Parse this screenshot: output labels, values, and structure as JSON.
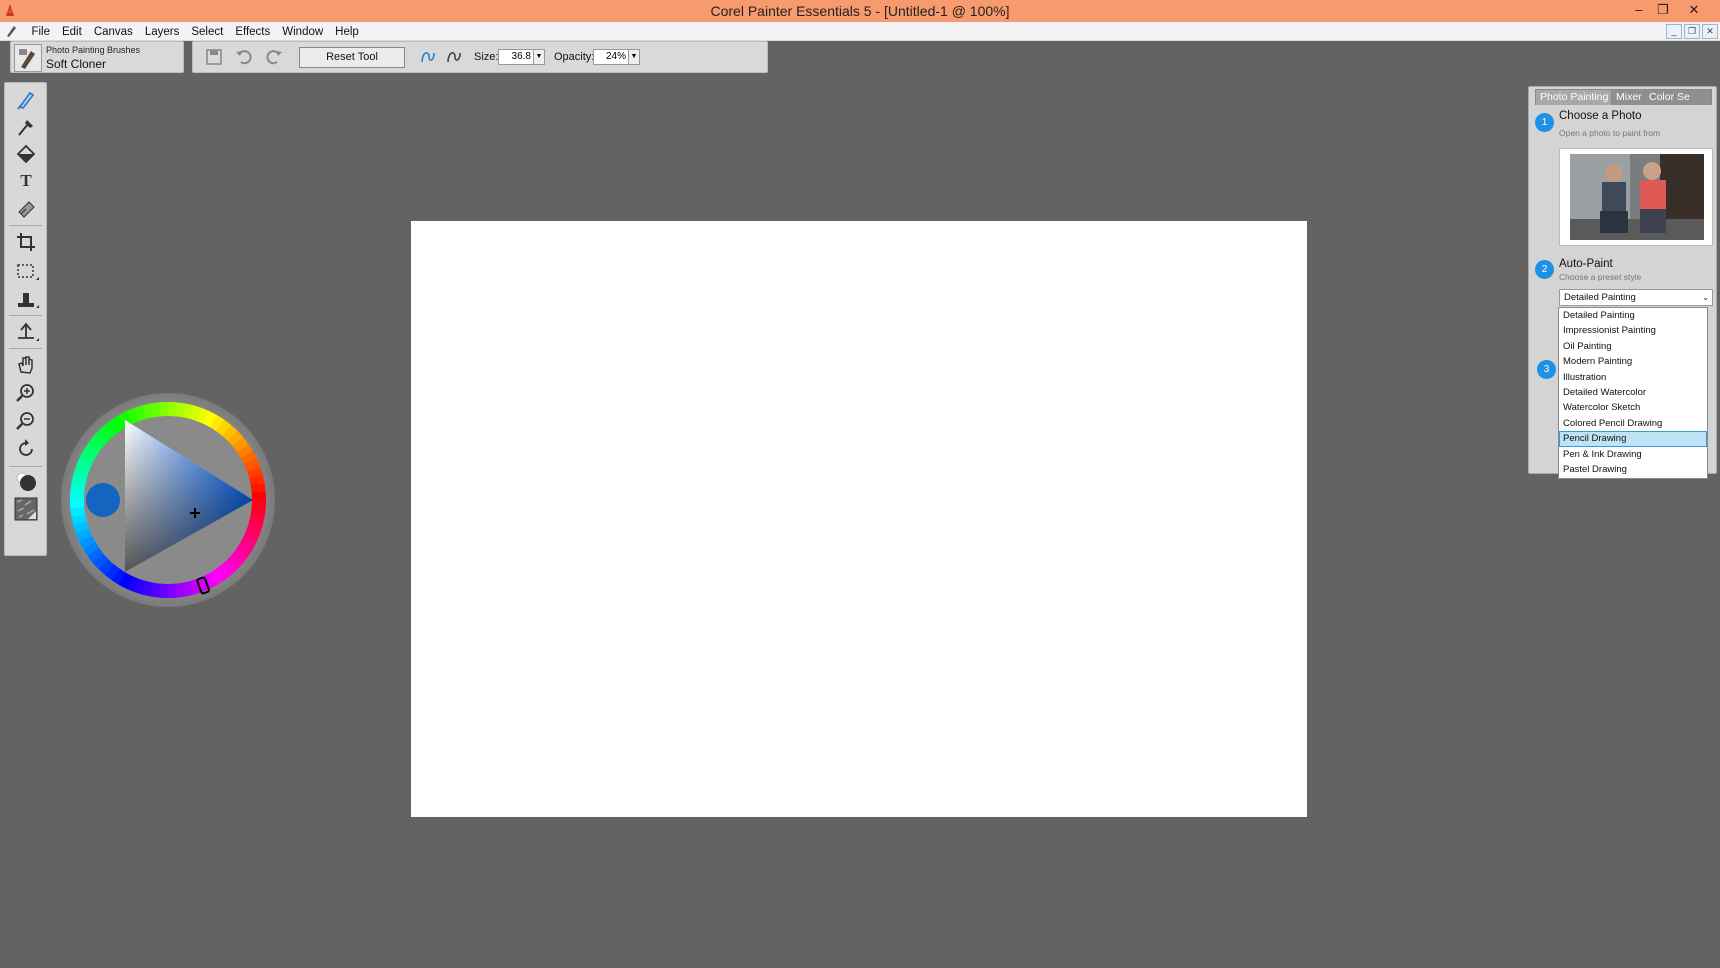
{
  "window": {
    "title": "Corel Painter Essentials 5 - [Untitled-1 @ 100%]",
    "minimize_icon": "minimize-icon",
    "restore_icon": "restore-icon",
    "close_icon": "close-icon"
  },
  "menubar": {
    "items": [
      "File",
      "Edit",
      "Canvas",
      "Layers",
      "Select",
      "Effects",
      "Window",
      "Help"
    ]
  },
  "brush": {
    "category": "Photo Painting Brushes",
    "variant": "Soft Cloner"
  },
  "property_bar": {
    "reset_label": "Reset Tool",
    "size_label": "Size:",
    "size_value": "36.8",
    "opacity_label": "Opacity:",
    "opacity_value": "24%"
  },
  "toolbox": {
    "tools": [
      "brush-icon",
      "dropper-icon",
      "paint-bucket-icon",
      "text-icon",
      "eraser-icon",
      "crop-icon",
      "rectangular-selection-icon",
      "clone-stamp-icon",
      "transform-icon",
      "grabber-hand-icon",
      "zoom-in-icon",
      "zoom-out-icon",
      "rotate-page-icon",
      "main-color-swatch",
      "paper-texture-icon"
    ]
  },
  "color": {
    "main_color": "#1565c0",
    "ring_handle": "hue-indicator"
  },
  "panel": {
    "tabs": [
      "Photo Painting",
      "Mixer",
      "Color Se"
    ],
    "step1": {
      "number": "1",
      "title": "Choose a Photo",
      "subtitle": "Open a photo to paint from"
    },
    "step2": {
      "number": "2",
      "title": "Auto-Paint",
      "subtitle": "Choose a preset style"
    },
    "step3": {
      "number": "3"
    },
    "preset_selected": "Detailed Painting",
    "preset_options": [
      "Detailed Painting",
      "Impressionist Painting",
      "Oil Painting",
      "Modern Painting",
      "Illustration",
      "Detailed Watercolor",
      "Watercolor Sketch",
      "Colored Pencil Drawing",
      "Pencil Drawing",
      "Pen & Ink Drawing",
      "Pastel Drawing"
    ],
    "highlighted_option": "Pencil Drawing"
  }
}
